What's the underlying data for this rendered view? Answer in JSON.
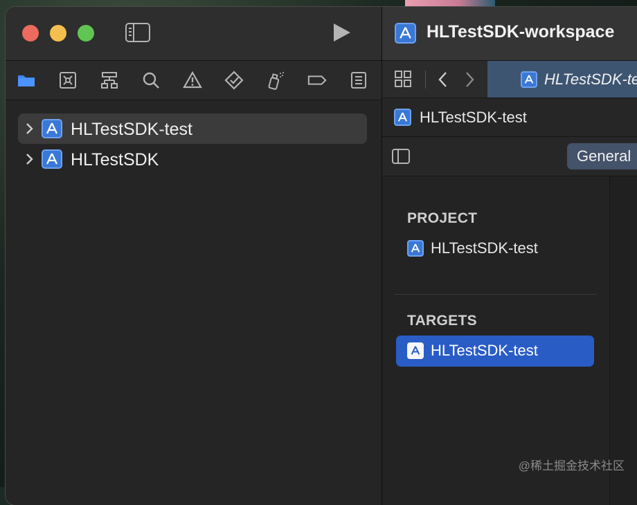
{
  "toolbar": {
    "run_icon": "play-icon",
    "sidebar_icon": "sidebar-toggle-icon"
  },
  "navigator": {
    "icons": [
      "folder-icon",
      "source-control-icon",
      "hierarchy-icon",
      "search-icon",
      "warning-icon",
      "test-diamond-icon",
      "debug-spray-icon",
      "breakpoint-tag-icon",
      "report-list-icon"
    ],
    "items": [
      {
        "label": "HLTestSDK-test",
        "selected": true
      },
      {
        "label": "HLTestSDK",
        "selected": false
      }
    ]
  },
  "editor": {
    "window_title": "HLTestSDK-workspace",
    "tab_label": "HLTestSDK-te",
    "jumpbar_label": "HLTestSDK-test",
    "settings_tab": "General",
    "project_header": "PROJECT",
    "project_item": "HLTestSDK-test",
    "targets_header": "TARGETS",
    "target_item": "HLTestSDK-test"
  },
  "watermark": "@稀土掘金技术社区",
  "colors": {
    "accent_blue": "#2a5cc5",
    "traffic_close": "#ed6a5e",
    "traffic_min": "#f5bf4f",
    "traffic_max": "#61c554"
  }
}
